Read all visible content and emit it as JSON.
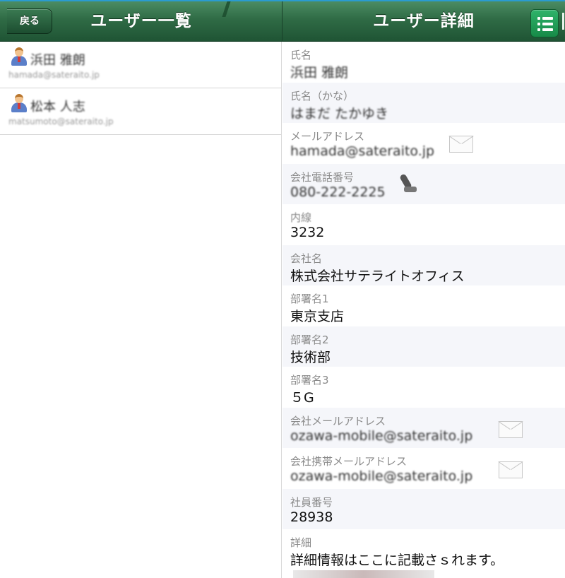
{
  "header": {
    "back_label": "戻る",
    "list_title": "ユーザー一覧",
    "detail_title": "ユーザー詳細"
  },
  "user_list": [
    {
      "name": "浜田 雅朗",
      "email": "hamada@sateraito.jp"
    },
    {
      "name": "松本 人志",
      "email": "matsumoto@sateraito.jp"
    }
  ],
  "details": [
    {
      "label": "氏名",
      "value": "浜田 雅朗"
    },
    {
      "label": "氏名（かな）",
      "value": "はまだ たかゆき"
    },
    {
      "label": "メールアドレス",
      "value": "hamada@sateraito.jp"
    },
    {
      "label": "会社電話番号",
      "value": "080-222-2225"
    },
    {
      "label": "内線",
      "value": "3232"
    },
    {
      "label": "会社名",
      "value": "株式会社サテライトオフィス"
    },
    {
      "label": "部署名1",
      "value": "東京支店"
    },
    {
      "label": "部署名2",
      "value": "技術部"
    },
    {
      "label": "部署名3",
      "value": "５G"
    },
    {
      "label": "会社メールアドレス",
      "value": "ozawa-mobile@sateraito.jp"
    },
    {
      "label": "会社携帯メールアドレス",
      "value": "ozawa-mobile@sateraito.jp"
    },
    {
      "label": "社員番号",
      "value": "28938"
    },
    {
      "label": "詳細",
      "value": "詳細情報はここに記載さｓれます。"
    }
  ],
  "colors": {
    "header_green": "#2f6b45",
    "menu_button_green": "#178a48",
    "alt_row": "#f5f6fa"
  },
  "icons": [
    "user-icon",
    "mail-icon",
    "phone-icon",
    "list-menu-icon",
    "back-arrow-icon"
  ]
}
